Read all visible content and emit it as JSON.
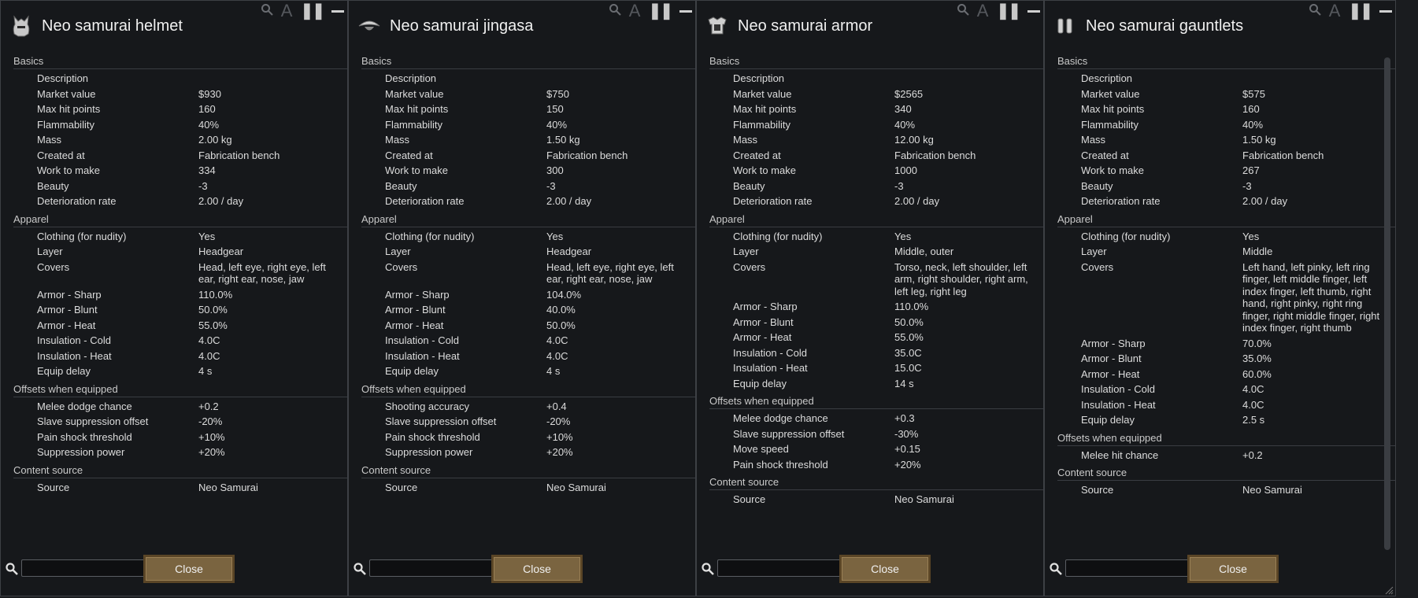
{
  "panels": [
    {
      "title": "Neo samurai helmet",
      "icon": "helmet-icon",
      "sections": [
        {
          "header": "Basics",
          "rows": [
            {
              "label": "Description",
              "value": ""
            },
            {
              "label": "Market value",
              "value": "$930"
            },
            {
              "label": "Max hit points",
              "value": "160"
            },
            {
              "label": "Flammability",
              "value": "40%"
            },
            {
              "label": "Mass",
              "value": "2.00 kg"
            },
            {
              "label": "Created at",
              "value": "Fabrication bench"
            },
            {
              "label": "Work to make",
              "value": "334"
            },
            {
              "label": "Beauty",
              "value": "-3"
            },
            {
              "label": "Deterioration rate",
              "value": "2.00 / day"
            }
          ]
        },
        {
          "header": "Apparel",
          "rows": [
            {
              "label": "Clothing (for nudity)",
              "value": "Yes"
            },
            {
              "label": "Layer",
              "value": "Headgear"
            },
            {
              "label": "Covers",
              "value": "Head, left eye, right eye, left ear, right ear, nose, jaw"
            },
            {
              "label": "Armor - Sharp",
              "value": "110.0%"
            },
            {
              "label": "Armor - Blunt",
              "value": "50.0%"
            },
            {
              "label": "Armor - Heat",
              "value": "55.0%"
            },
            {
              "label": "Insulation - Cold",
              "value": "4.0C"
            },
            {
              "label": "Insulation - Heat",
              "value": "4.0C"
            },
            {
              "label": "Equip delay",
              "value": "4 s"
            }
          ]
        },
        {
          "header": "Offsets when equipped",
          "rows": [
            {
              "label": "Melee dodge chance",
              "value": "+0.2"
            },
            {
              "label": "Slave suppression offset",
              "value": "-20%"
            },
            {
              "label": "Pain shock threshold",
              "value": "+10%"
            },
            {
              "label": "Suppression power",
              "value": "+20%"
            }
          ]
        },
        {
          "header": "Content source",
          "rows": [
            {
              "label": "Source",
              "value": "Neo Samurai"
            }
          ]
        }
      ],
      "close_label": "Close",
      "has_scrollbar": false
    },
    {
      "title": "Neo samurai jingasa",
      "icon": "jingasa-hat-icon",
      "sections": [
        {
          "header": "Basics",
          "rows": [
            {
              "label": "Description",
              "value": ""
            },
            {
              "label": "Market value",
              "value": "$750"
            },
            {
              "label": "Max hit points",
              "value": "150"
            },
            {
              "label": "Flammability",
              "value": "40%"
            },
            {
              "label": "Mass",
              "value": "1.50 kg"
            },
            {
              "label": "Created at",
              "value": "Fabrication bench"
            },
            {
              "label": "Work to make",
              "value": "300"
            },
            {
              "label": "Beauty",
              "value": "-3"
            },
            {
              "label": "Deterioration rate",
              "value": "2.00 / day"
            }
          ]
        },
        {
          "header": "Apparel",
          "rows": [
            {
              "label": "Clothing (for nudity)",
              "value": "Yes"
            },
            {
              "label": "Layer",
              "value": "Headgear"
            },
            {
              "label": "Covers",
              "value": "Head, left eye, right eye, left ear, right ear, nose, jaw"
            },
            {
              "label": "Armor - Sharp",
              "value": "104.0%"
            },
            {
              "label": "Armor - Blunt",
              "value": "40.0%"
            },
            {
              "label": "Armor - Heat",
              "value": "50.0%"
            },
            {
              "label": "Insulation - Cold",
              "value": "4.0C"
            },
            {
              "label": "Insulation - Heat",
              "value": "4.0C"
            },
            {
              "label": "Equip delay",
              "value": "4 s"
            }
          ]
        },
        {
          "header": "Offsets when equipped",
          "rows": [
            {
              "label": "Shooting accuracy",
              "value": "+0.4"
            },
            {
              "label": "Slave suppression offset",
              "value": "-20%"
            },
            {
              "label": "Pain shock threshold",
              "value": "+10%"
            },
            {
              "label": "Suppression power",
              "value": "+20%"
            }
          ]
        },
        {
          "header": "Content source",
          "rows": [
            {
              "label": "Source",
              "value": "Neo Samurai"
            }
          ]
        }
      ],
      "close_label": "Close",
      "has_scrollbar": false
    },
    {
      "title": "Neo samurai armor",
      "icon": "armor-icon",
      "sections": [
        {
          "header": "Basics",
          "rows": [
            {
              "label": "Description",
              "value": ""
            },
            {
              "label": "Market value",
              "value": "$2565"
            },
            {
              "label": "Max hit points",
              "value": "340"
            },
            {
              "label": "Flammability",
              "value": "40%"
            },
            {
              "label": "Mass",
              "value": "12.00 kg"
            },
            {
              "label": "Created at",
              "value": "Fabrication bench"
            },
            {
              "label": "Work to make",
              "value": "1000"
            },
            {
              "label": "Beauty",
              "value": "-3"
            },
            {
              "label": "Deterioration rate",
              "value": "2.00 / day"
            }
          ]
        },
        {
          "header": "Apparel",
          "rows": [
            {
              "label": "Clothing (for nudity)",
              "value": "Yes"
            },
            {
              "label": "Layer",
              "value": "Middle, outer"
            },
            {
              "label": "Covers",
              "value": "Torso, neck, left shoulder, left arm, right shoulder, right arm, left leg, right leg"
            },
            {
              "label": "Armor - Sharp",
              "value": "110.0%"
            },
            {
              "label": "Armor - Blunt",
              "value": "50.0%"
            },
            {
              "label": "Armor - Heat",
              "value": "55.0%"
            },
            {
              "label": "Insulation - Cold",
              "value": "35.0C"
            },
            {
              "label": "Insulation - Heat",
              "value": "15.0C"
            },
            {
              "label": "Equip delay",
              "value": "14 s"
            }
          ]
        },
        {
          "header": "Offsets when equipped",
          "rows": [
            {
              "label": "Melee dodge chance",
              "value": "+0.3"
            },
            {
              "label": "Slave suppression offset",
              "value": "-30%"
            },
            {
              "label": "Move speed",
              "value": "+0.15"
            },
            {
              "label": "Pain shock threshold",
              "value": "+20%"
            }
          ]
        },
        {
          "header": "Content source",
          "rows": [
            {
              "label": "Source",
              "value": "Neo Samurai"
            }
          ]
        }
      ],
      "close_label": "Close",
      "has_scrollbar": false
    },
    {
      "title": "Neo samurai gauntlets",
      "icon": "gauntlets-icon",
      "sections": [
        {
          "header": "Basics",
          "rows": [
            {
              "label": "Description",
              "value": ""
            },
            {
              "label": "Market value",
              "value": "$575"
            },
            {
              "label": "Max hit points",
              "value": "160"
            },
            {
              "label": "Flammability",
              "value": "40%"
            },
            {
              "label": "Mass",
              "value": "1.50 kg"
            },
            {
              "label": "Created at",
              "value": "Fabrication bench"
            },
            {
              "label": "Work to make",
              "value": "267"
            },
            {
              "label": "Beauty",
              "value": "-3"
            },
            {
              "label": "Deterioration rate",
              "value": "2.00 / day"
            }
          ]
        },
        {
          "header": "Apparel",
          "rows": [
            {
              "label": "Clothing (for nudity)",
              "value": "Yes"
            },
            {
              "label": "Layer",
              "value": "Middle"
            },
            {
              "label": "Covers",
              "value": "Left hand, left pinky, left ring finger, left middle finger, left index finger, left thumb, right hand, right pinky, right ring finger, right middle finger, right index finger, right thumb"
            },
            {
              "label": "Armor - Sharp",
              "value": "70.0%"
            },
            {
              "label": "Armor - Blunt",
              "value": "35.0%"
            },
            {
              "label": "Armor - Heat",
              "value": "60.0%"
            },
            {
              "label": "Insulation - Cold",
              "value": "4.0C"
            },
            {
              "label": "Insulation - Heat",
              "value": "4.0C"
            },
            {
              "label": "Equip delay",
              "value": "2.5 s"
            }
          ]
        },
        {
          "header": "Offsets when equipped",
          "rows": [
            {
              "label": "Melee hit chance",
              "value": "+0.2"
            }
          ]
        },
        {
          "header": "Content source",
          "rows": [
            {
              "label": "Source",
              "value": "Neo Samurai"
            }
          ]
        }
      ],
      "close_label": "Close",
      "has_scrollbar": true
    }
  ],
  "colors": {
    "panel_bg": "#16181b",
    "button_bg": "#7a6440",
    "text": "#dcdcdc"
  }
}
